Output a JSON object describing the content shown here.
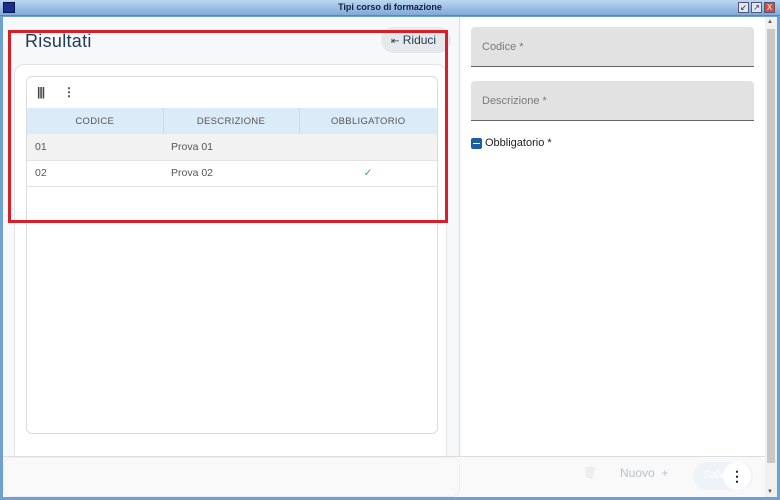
{
  "window": {
    "title": "Tipi corso di formazione",
    "controls": [
      "↙",
      "↗",
      "X"
    ]
  },
  "left": {
    "title": "Risultati",
    "collapse_label": "Riduci",
    "collapse_icon": "⇤",
    "table": {
      "columns": [
        "CODICE",
        "DESCRIZIONE",
        "OBBLIGATORIO"
      ],
      "rows": [
        {
          "codice": "01",
          "descrizione": "Prova 01",
          "obbligatorio": ""
        },
        {
          "codice": "02",
          "descrizione": "Prova 02",
          "obbligatorio": "✓"
        }
      ]
    }
  },
  "right": {
    "fields": {
      "codice": "Codice *",
      "descrizione": "Descrizione *"
    },
    "checkbox_label": "Obbligatorio *",
    "checkbox_state": "indeterminate"
  },
  "footer": {
    "new_label": "Nuovo",
    "new_icon": "+",
    "save_label": "Salva",
    "more_icon": "⋮"
  },
  "colors": {
    "accent": "#1c5fa0",
    "highlight": "#d71f2a",
    "header_bg": "#dcebf8",
    "check": "#3aa76d"
  }
}
